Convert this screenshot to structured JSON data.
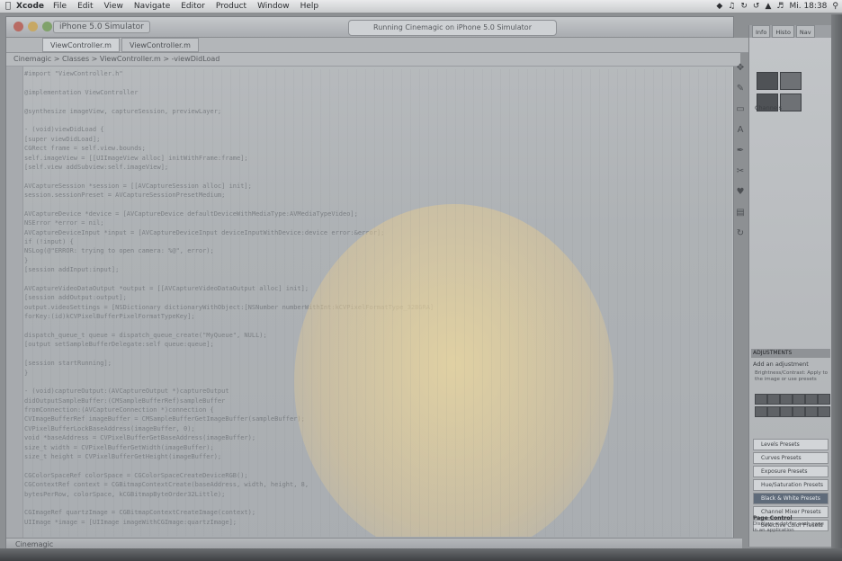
{
  "menubar": {
    "apple": "",
    "app_name": "Xcode",
    "items": [
      "File",
      "Edit",
      "View",
      "Navigate",
      "Editor",
      "Product",
      "Window",
      "Help"
    ],
    "status": [
      "Mi. 18:38"
    ]
  },
  "window": {
    "scheme": "iPhone 5.0 Simulator",
    "activity": "Running Cinemagic on iPhone 5.0 Simulator",
    "tabs": [
      "ViewController.m",
      "ViewController.m"
    ],
    "jumpbar": "Cinemagic > Classes > ViewController.m > -viewDidLoad",
    "status": "Cinemagic"
  },
  "code_lines": [
    "#import \"ViewController.h\"",
    "",
    "@implementation ViewController",
    "",
    "@synthesize imageView, captureSession, previewLayer;",
    "",
    "- (void)viewDidLoad {",
    "    [super viewDidLoad];",
    "    CGRect frame = self.view.bounds;",
    "    self.imageView = [[UIImageView alloc] initWithFrame:frame];",
    "    [self.view addSubview:self.imageView];",
    "",
    "    AVCaptureSession *session = [[AVCaptureSession alloc] init];",
    "    session.sessionPreset = AVCaptureSessionPresetMedium;",
    "",
    "    AVCaptureDevice *device = [AVCaptureDevice defaultDeviceWithMediaType:AVMediaTypeVideo];",
    "    NSError *error = nil;",
    "    AVCaptureDeviceInput *input = [AVCaptureDeviceInput deviceInputWithDevice:device error:&error];",
    "    if (!input) {",
    "        NSLog(@\"ERROR: trying to open camera: %@\", error);",
    "    }",
    "    [session addInput:input];",
    "",
    "    AVCaptureVideoDataOutput *output = [[AVCaptureVideoDataOutput alloc] init];",
    "    [session addOutput:output];",
    "    output.videoSettings = [NSDictionary dictionaryWithObject:[NSNumber numberWithInt:kCVPixelFormatType_32BGRA]",
    "                                                       forKey:(id)kCVPixelBufferPixelFormatTypeKey];",
    "",
    "    dispatch_queue_t queue = dispatch_queue_create(\"MyQueue\", NULL);",
    "    [output setSampleBufferDelegate:self queue:queue];",
    "",
    "    [session startRunning];",
    "}",
    "",
    "- (void)captureOutput:(AVCaptureOutput *)captureOutput",
    "didOutputSampleBuffer:(CMSampleBufferRef)sampleBuffer",
    "       fromConnection:(AVCaptureConnection *)connection {",
    "    CVImageBufferRef imageBuffer = CMSampleBufferGetImageBuffer(sampleBuffer);",
    "    CVPixelBufferLockBaseAddress(imageBuffer, 0);",
    "    void *baseAddress = CVPixelBufferGetBaseAddress(imageBuffer);",
    "    size_t width = CVPixelBufferGetWidth(imageBuffer);",
    "    size_t height = CVPixelBufferGetHeight(imageBuffer);",
    "",
    "    CGColorSpaceRef colorSpace = CGColorSpaceCreateDeviceRGB();",
    "    CGContextRef context = CGBitmapContextCreate(baseAddress, width, height, 8,",
    "        bytesPerRow, colorSpace, kCGBitmapByteOrder32Little);",
    "",
    "    CGImageRef quartzImage = CGBitmapContextCreateImage(context);",
    "    UIImage *image = [UIImage imageWithCGImage:quartzImage];",
    "",
    "    [self.imageView performSelectorOnMainThread:@selector(setImage:)"
  ],
  "inspector": {
    "tabs": [
      "Info",
      "Histo",
      "Nav"
    ],
    "label": "Channels",
    "adjustments_title": "ADJUSTMENTS",
    "adjustments_sub": "Add an adjustment",
    "adjustments_desc": "Brightness/Contrast: Apply to the image or use presets",
    "presets": [
      "Levels Presets",
      "Curves Presets",
      "Exposure Presets",
      "Hue/Saturation Presets",
      "Black & White Presets",
      "Channel Mixer Presets",
      "Selective Color Presets"
    ],
    "help_title": "Page Control",
    "help_text": "Displays a dot for each page in an application"
  }
}
